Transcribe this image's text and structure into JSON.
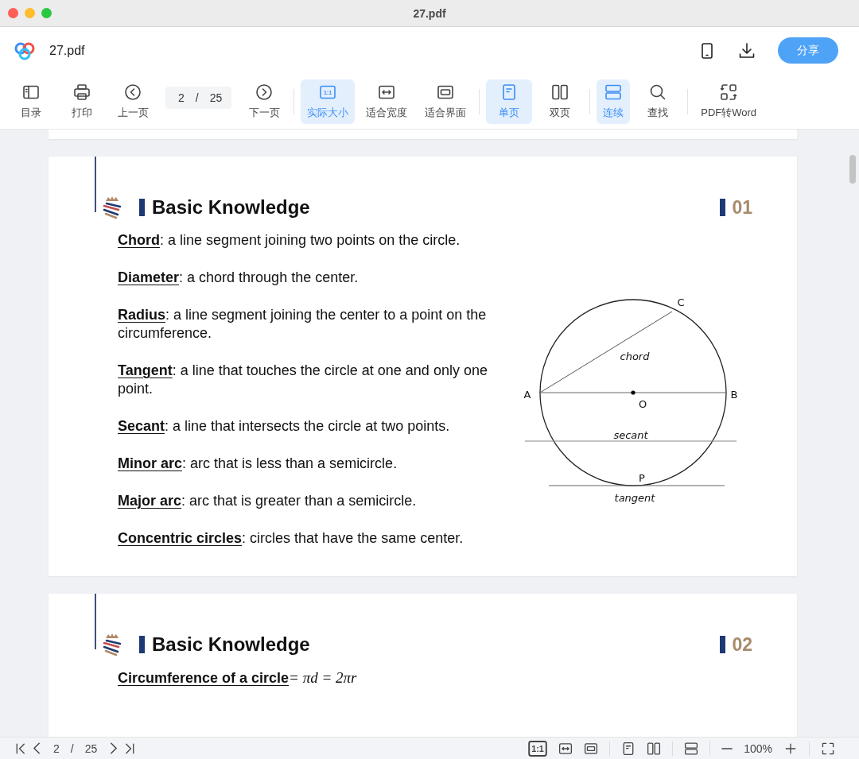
{
  "window": {
    "title": "27.pdf"
  },
  "header": {
    "file_name": "27.pdf",
    "share_button": "分享"
  },
  "toolbar": {
    "groups": [
      [
        {
          "kind": "contents",
          "label": "目录"
        },
        {
          "kind": "print",
          "label": "打印"
        },
        {
          "kind": "prev",
          "label": "上一页"
        },
        {
          "kind": "page",
          "current": "2",
          "separator": "/",
          "total": "25"
        },
        {
          "kind": "next",
          "label": "下一页"
        }
      ],
      [
        {
          "kind": "actual",
          "label": "实际大小",
          "icon_text": "1:1",
          "selected": true
        },
        {
          "kind": "fitwidth",
          "label": "适合宽度",
          "selected": false
        },
        {
          "kind": "fitscreen",
          "label": "适合界面",
          "selected": false
        }
      ],
      [
        {
          "kind": "single",
          "label": "单页",
          "selected": true
        },
        {
          "kind": "double",
          "label": "双页",
          "selected": false
        }
      ],
      [
        {
          "kind": "continuous",
          "label": "连续",
          "selected": true
        },
        {
          "kind": "search",
          "label": "查找"
        }
      ],
      [
        {
          "kind": "convert",
          "label": "PDF转Word"
        }
      ]
    ]
  },
  "pages": [
    {
      "kind": "slice"
    },
    {
      "kind": "page",
      "section": "Basic Knowledge",
      "number": "01",
      "definitions": [
        {
          "term": "Chord",
          "text": ": a line segment joining two points on the circle."
        },
        {
          "term": "Diameter",
          "text": ": a chord through the center."
        },
        {
          "term": "Radius",
          "text": ": a line segment joining the center to a point on the circumference."
        },
        {
          "term": "Tangent",
          "text": ": a line that touches the circle at one and only one point."
        },
        {
          "term": "Secant",
          "text": ": a line that intersects the circle at two points."
        },
        {
          "term": "Minor arc",
          "text": ": arc that is less than a semicircle."
        },
        {
          "term": "Major arc",
          "text": ": arc that is greater than a semicircle."
        },
        {
          "term": "Concentric circles",
          "text": ": circles that have the same center."
        }
      ],
      "diagram": {
        "labels": [
          {
            "text": "C",
            "kind": "point"
          },
          {
            "text": "chord",
            "kind": "line"
          },
          {
            "text": "A",
            "kind": "point"
          },
          {
            "text": "O",
            "kind": "point"
          },
          {
            "text": "B",
            "kind": "point"
          },
          {
            "text": "secant",
            "kind": "line"
          },
          {
            "text": "P",
            "kind": "point"
          },
          {
            "text": "tangent",
            "kind": "line"
          }
        ]
      }
    },
    {
      "kind": "page",
      "section": "Basic Knowledge",
      "number": "02",
      "definitions": [
        {
          "term": "Circumference of a circle",
          "formula": "= πd = 2πr"
        }
      ]
    }
  ],
  "status_bar": {
    "left": [
      {
        "kind": "first"
      },
      {
        "kind": "prev"
      },
      {
        "kind": "page",
        "current": "2",
        "separator": "/",
        "total": "25"
      },
      {
        "kind": "next"
      },
      {
        "kind": "last"
      }
    ],
    "right": [
      [
        {
          "kind": "actual",
          "icon_text": "1:1"
        },
        {
          "kind": "fitwidth"
        },
        {
          "kind": "fitscreen"
        }
      ],
      [
        {
          "kind": "single"
        },
        {
          "kind": "double"
        }
      ],
      [
        {
          "kind": "continuous"
        }
      ],
      [
        {
          "kind": "zoom-out"
        },
        {
          "kind": "zoom-level",
          "text": "100%"
        },
        {
          "kind": "zoom-in"
        }
      ],
      [
        {
          "kind": "fullscreen"
        }
      ]
    ]
  }
}
